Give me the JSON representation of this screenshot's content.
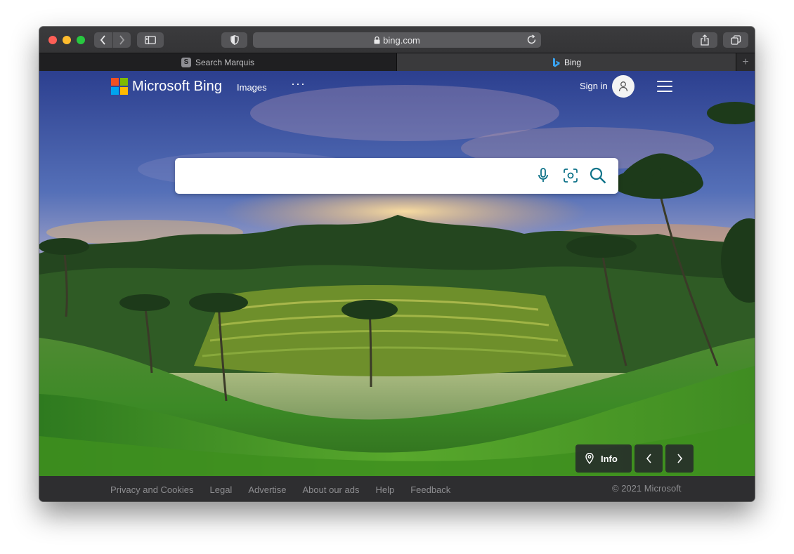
{
  "browser": {
    "url": "bing.com",
    "tabs": [
      {
        "label": "Search Marquis",
        "badge": "S",
        "active": false
      },
      {
        "label": "Bing",
        "active": true
      }
    ],
    "new_tab": "+"
  },
  "header": {
    "logo_text": "Microsoft Bing",
    "nav": [
      {
        "label": "Images"
      }
    ],
    "more": "···",
    "sign_in": "Sign in"
  },
  "search": {
    "value": "",
    "placeholder": ""
  },
  "background": {
    "info_label": "Info"
  },
  "footer": {
    "links": [
      "Privacy and Cookies",
      "Legal",
      "Advertise",
      "About our ads",
      "Help",
      "Feedback"
    ],
    "copyright": "© 2021 Microsoft"
  },
  "colors": {
    "accent": "#0f7389",
    "ms_red": "#f25022",
    "ms_green": "#7fba00",
    "ms_blue": "#00a4ef",
    "ms_yellow": "#ffb900"
  }
}
